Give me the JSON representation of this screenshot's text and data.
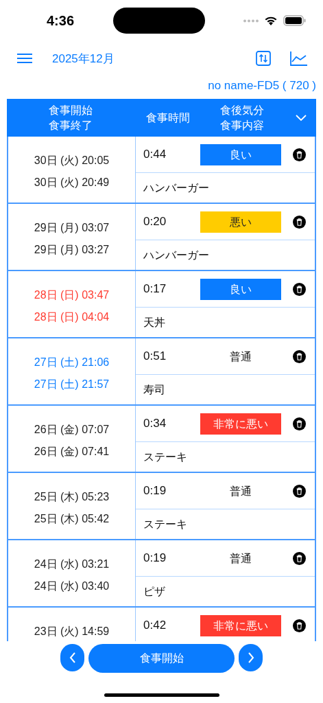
{
  "status_bar": {
    "time": "4:36"
  },
  "toolbar": {
    "title": "2025年12月"
  },
  "device_label": "no name-FD5 ( 720 )",
  "table": {
    "columns": [
      {
        "lines": [
          "食事開始",
          "食事終了"
        ]
      },
      {
        "lines": [
          "食事時間"
        ]
      },
      {
        "lines": [
          "食後気分",
          "食事内容"
        ]
      }
    ],
    "rows": [
      {
        "kind": "weekday",
        "start": "30日 (火) 20:05",
        "end": "30日 (火) 20:49",
        "duration": "0:44",
        "mood": {
          "text": "良い",
          "color": "#0a7cff"
        },
        "food": "ハンバーガー"
      },
      {
        "kind": "weekday",
        "start": "29日 (月) 03:07",
        "end": "29日 (月) 03:27",
        "duration": "0:20",
        "mood": {
          "text": "悪い",
          "color": "#ffcc00"
        },
        "food": "ハンバーガー"
      },
      {
        "kind": "sunday",
        "start": "28日 (日) 03:47",
        "end": "28日 (日) 04:04",
        "duration": "0:17",
        "mood": {
          "text": "良い",
          "color": "#0a7cff"
        },
        "food": "天丼"
      },
      {
        "kind": "saturday",
        "start": "27日 (土) 21:06",
        "end": "27日 (土) 21:57",
        "duration": "0:51",
        "mood": {
          "text": "普通"
        },
        "food": "寿司"
      },
      {
        "kind": "weekday",
        "start": "26日 (金) 07:07",
        "end": "26日 (金) 07:41",
        "duration": "0:34",
        "mood": {
          "text": "非常に悪い",
          "color": "#ff3b30"
        },
        "food": "ステーキ"
      },
      {
        "kind": "weekday",
        "start": "25日 (木) 05:23",
        "end": "25日 (木) 05:42",
        "duration": "0:19",
        "mood": {
          "text": "普通"
        },
        "food": "ステーキ"
      },
      {
        "kind": "weekday",
        "start": "24日 (水) 03:21",
        "end": "24日 (水) 03:40",
        "duration": "0:19",
        "mood": {
          "text": "普通"
        },
        "food": "ピザ"
      },
      {
        "kind": "weekday",
        "start": "23日 (火) 14:59",
        "duration": "0:42",
        "mood": {
          "text": "非常に悪い",
          "color": "#ff3b30"
        }
      }
    ]
  },
  "start_button": "食事開始"
}
